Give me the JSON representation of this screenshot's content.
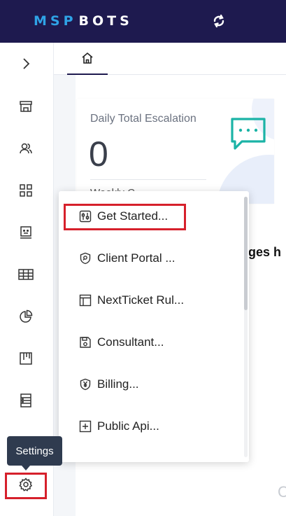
{
  "brand": {
    "logo_part1": "MSP",
    "logo_part2": "BOTS",
    "primary_color": "#1e1a4f",
    "accent_color": "#2fa3e6"
  },
  "header": {
    "refresh_icon": "refresh-icon"
  },
  "sidebar": {
    "items": [
      {
        "name": "expand",
        "icon": "chevron-right-icon"
      },
      {
        "name": "store",
        "icon": "store-icon"
      },
      {
        "name": "users",
        "icon": "user-group-icon"
      },
      {
        "name": "apps",
        "icon": "grid-icon"
      },
      {
        "name": "bots",
        "icon": "bot-face-icon"
      },
      {
        "name": "datasets",
        "icon": "table-icon"
      },
      {
        "name": "dashboards",
        "icon": "pie-chart-icon"
      },
      {
        "name": "boards",
        "icon": "kanban-icon"
      },
      {
        "name": "reports",
        "icon": "list-icon"
      },
      {
        "name": "settings",
        "icon": "gear-icon"
      }
    ],
    "tooltip": "Settings"
  },
  "tabs": {
    "home_icon": "home-icon"
  },
  "card": {
    "title": "Daily Total Escalation",
    "value": "0",
    "subtitle": "Weekly C..."
  },
  "section": {
    "title": "ages h"
  },
  "faint_text": "C",
  "settings_menu": {
    "items": [
      {
        "label": "Get Started...",
        "icon": "sliders-icon"
      },
      {
        "label": "Client Portal ...",
        "icon": "shield-search-icon"
      },
      {
        "label": "NextTicket Rul...",
        "icon": "layout-icon"
      },
      {
        "label": "Consultant...",
        "icon": "save-icon"
      },
      {
        "label": "Billing...",
        "icon": "yen-shield-icon"
      },
      {
        "label": "Public Api...",
        "icon": "plus-square-icon"
      }
    ]
  },
  "highlight_color": "#d6202b"
}
